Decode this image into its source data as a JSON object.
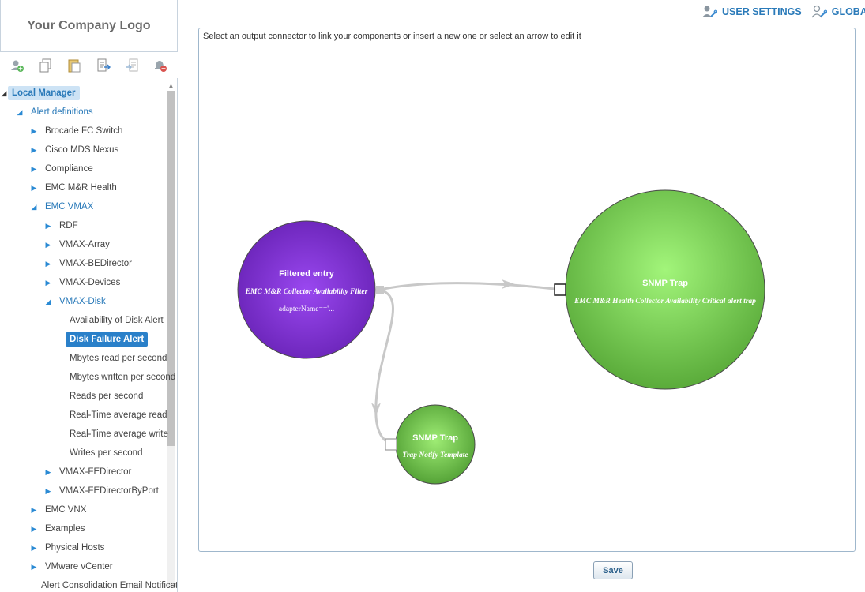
{
  "logo": {
    "text": "Your Company Logo"
  },
  "toolbar": {
    "buttons": [
      {
        "icon": "add-alert-icon"
      },
      {
        "icon": "copy-icon"
      },
      {
        "icon": "paste-icon"
      },
      {
        "icon": "export-icon"
      },
      {
        "icon": "import-icon"
      },
      {
        "icon": "delete-alert-icon"
      }
    ]
  },
  "header": {
    "user_settings": "USER SETTINGS",
    "global": "GLOBAL"
  },
  "tree": {
    "local_manager": "Local Manager",
    "alert_definitions": "Alert definitions",
    "brocade": "Brocade FC Switch",
    "cisco": "Cisco MDS Nexus",
    "compliance": "Compliance",
    "emc_mr_health": "EMC M&R Health",
    "emc_vmax": "EMC VMAX",
    "rdf": "RDF",
    "vmax_array": "VMAX-Array",
    "vmax_bedirector": "VMAX-BEDirector",
    "vmax_devices": "VMAX-Devices",
    "vmax_disk": "VMAX-Disk",
    "availability_disk_alert": "Availability of Disk Alert",
    "disk_failure_alert": "Disk Failure Alert",
    "mbytes_read": "Mbytes read per second",
    "mbytes_written": "Mbytes written per second",
    "reads_per_second": "Reads per second",
    "rt_avg_read": "Real-Time average read",
    "rt_avg_write": "Real-Time average write",
    "writes_per_second": "Writes per second",
    "vmax_fedirector": "VMAX-FEDirector",
    "vmax_fedirector_by_port": "VMAX-FEDirectorByPort",
    "emc_vnx": "EMC VNX",
    "examples": "Examples",
    "physical_hosts": "Physical Hosts",
    "vmware_vcenter": "VMware vCenter",
    "alert_consolidation": "Alert Consolidation Email Notification"
  },
  "canvas": {
    "instructions": "Select an output connector to link your components or insert a new one or select an arrow to edit it"
  },
  "diagram": {
    "filter_node": {
      "title": "Filtered entry",
      "subtitle": "EMC M&R Collector Availability Filter",
      "value": "adapterName=='...",
      "color": "#7a2fc9"
    },
    "snmp_trap_main": {
      "title": "SNMP Trap",
      "subtitle": "EMC M&R Health Collector Availability Critical alert trap",
      "color": "#6fc64a"
    },
    "snmp_trap_small": {
      "title": "SNMP Trap",
      "subtitle": "Trap Notify Template",
      "color": "#6fc64a"
    }
  },
  "save_label": "Save",
  "colors": {
    "accent": "#2a80c9",
    "link": "#2a7ab9",
    "purple_node": "#7a2fc9",
    "green_node": "#6fc64a"
  }
}
